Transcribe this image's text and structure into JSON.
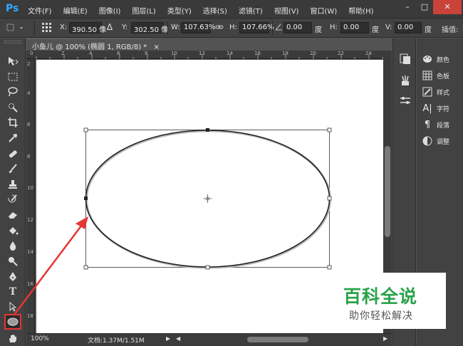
{
  "app": {
    "logo": "Ps"
  },
  "menu": [
    "文件(F)",
    "编辑(E)",
    "图像(I)",
    "图层(L)",
    "类型(Y)",
    "选择(S)",
    "滤镜(T)",
    "视图(V)",
    "窗口(W)",
    "帮助(H)"
  ],
  "window_controls": {
    "minimize": "–",
    "maximize": "□",
    "close": "✕"
  },
  "options": {
    "x_label": "X:",
    "x_value": "390.50 像",
    "y_label": "Y:",
    "y_value": "302.50 像",
    "w_label": "W:",
    "w_value": "107.63%",
    "h_label": "H:",
    "h_value": "107.66%",
    "angle_value": "0.00",
    "angle_unit": "度",
    "hskew_label": "H:",
    "hskew_value": "0.00",
    "hskew_unit": "度",
    "vskew_label": "V:",
    "vskew_value": "0.00",
    "vskew_unit": "度",
    "interp_label": "插值:"
  },
  "document": {
    "tab_label": "小鱼儿 @ 100% (椭圆 1, RGB/8) *",
    "close": "×"
  },
  "ruler": {
    "h_ticks": [
      "0",
      "2",
      "4",
      "6",
      "8",
      "10",
      "12",
      "14",
      "16",
      "18",
      "20",
      "22",
      "24"
    ],
    "v_ticks": [
      "2",
      "4",
      "6",
      "8",
      "10",
      "12",
      "14",
      "16",
      "18"
    ]
  },
  "status": {
    "zoom": "100%",
    "doc_info": "文档:1.37M/1.51M"
  },
  "panels": [
    "颜色",
    "色板",
    "样式",
    "字符",
    "段落",
    "调整"
  ],
  "watermark": {
    "title": "百科全说",
    "subtitle": "助你轻松解决"
  },
  "colors": {
    "accent": "#31a8ff",
    "highlight": "#e53535",
    "watermark_green": "#2aa24a"
  }
}
